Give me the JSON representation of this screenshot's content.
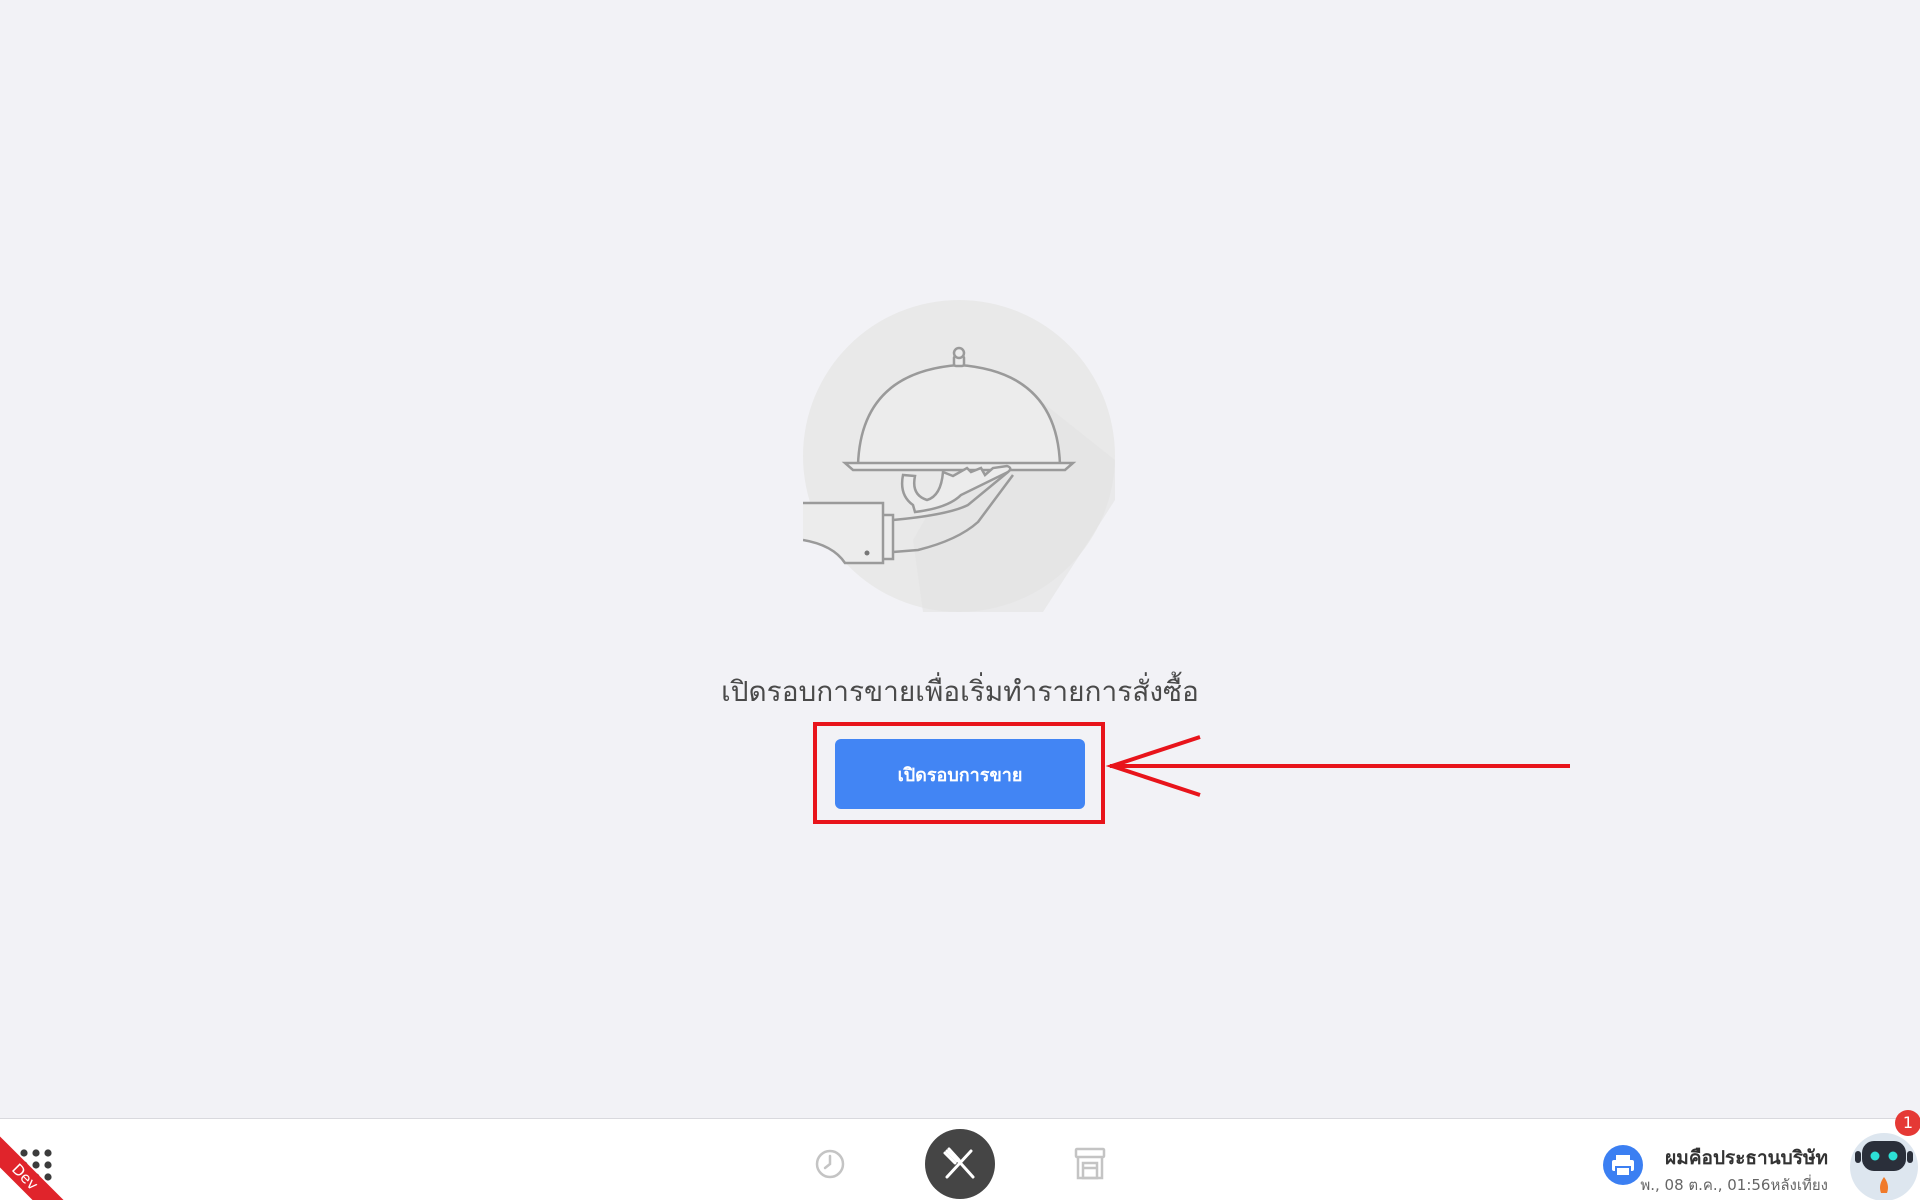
{
  "main": {
    "prompt": "เปิดรอบการขายเพื่อเริ่มทำรายการสั่งซื้อ",
    "open_button_label": "เปิดรอบการขาย"
  },
  "bottom_bar": {
    "env_ribbon": "Dev",
    "user_name": "ผมคือประธานบริษัท",
    "datetime": "พ., 08 ต.ค., 01:56หลังเที่ยง",
    "notification_count": "1",
    "nav": [
      {
        "name": "history",
        "icon": "clock-icon",
        "active": false
      },
      {
        "name": "menu",
        "icon": "fork-knife-icon",
        "active": true
      },
      {
        "name": "store",
        "icon": "store-icon",
        "active": false
      }
    ]
  },
  "colors": {
    "background": "#f2f2f6",
    "primary_button": "#4285f4",
    "annotation_red": "#e8141b",
    "active_nav": "#454545",
    "printer_button": "#3b7ff2",
    "badge": "#e53935"
  }
}
